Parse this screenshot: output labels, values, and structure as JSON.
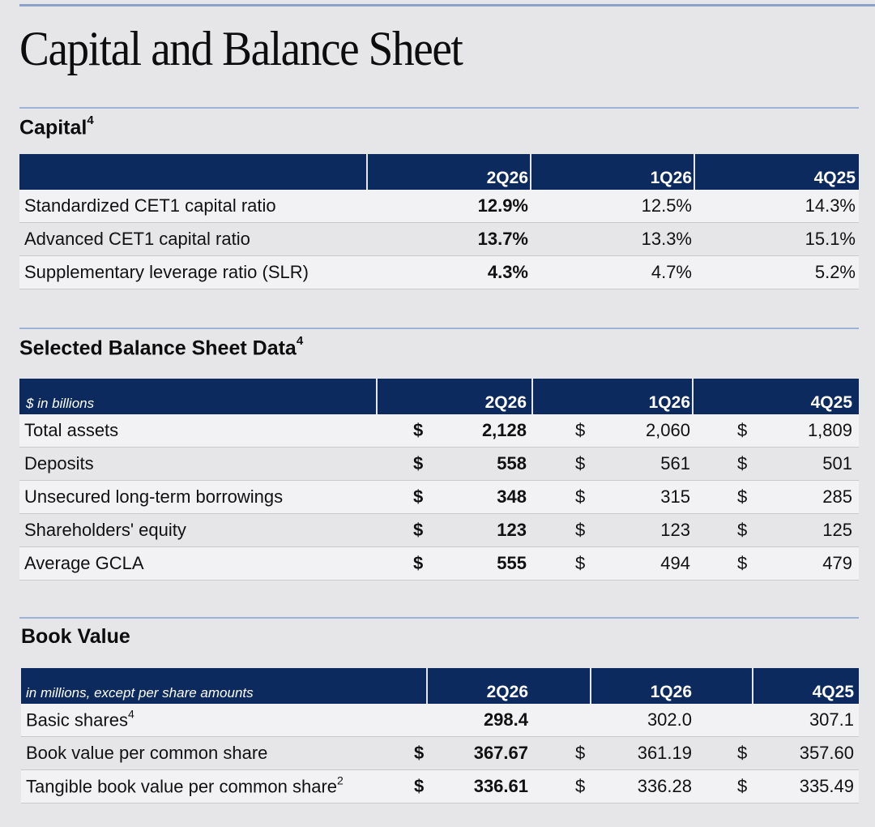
{
  "page": {
    "title": "Capital and Balance Sheet"
  },
  "capital": {
    "title": "Capital",
    "sup": "4",
    "columns": [
      "2Q26",
      "1Q26",
      "4Q25"
    ],
    "rows": [
      {
        "label": "Standardized CET1 capital ratio",
        "values": [
          "12.9%",
          "12.5%",
          "14.3%"
        ]
      },
      {
        "label": "Advanced CET1 capital ratio",
        "values": [
          "13.7%",
          "13.3%",
          "15.1%"
        ]
      },
      {
        "label": "Supplementary leverage ratio (SLR)",
        "values": [
          "4.3%",
          "4.7%",
          "5.2%"
        ]
      }
    ]
  },
  "balance_sheet": {
    "title": "Selected Balance Sheet Data",
    "sup": "4",
    "unit": "$ in billions",
    "currency": "$",
    "columns": [
      "2Q26",
      "1Q26",
      "4Q25"
    ],
    "rows": [
      {
        "label": "Total assets",
        "values": [
          "2,128",
          "2,060",
          "1,809"
        ]
      },
      {
        "label": "Deposits",
        "values": [
          "558",
          "561",
          "501"
        ]
      },
      {
        "label": "Unsecured long-term borrowings",
        "values": [
          "348",
          "315",
          "285"
        ]
      },
      {
        "label": "Shareholders' equity",
        "values": [
          "123",
          "123",
          "125"
        ]
      },
      {
        "label": "Average GCLA",
        "values": [
          "555",
          "494",
          "479"
        ]
      }
    ]
  },
  "book_value": {
    "title": "Book Value",
    "unit": "in millions, except per share amounts",
    "currency": "$",
    "columns": [
      "2Q26",
      "1Q26",
      "4Q25"
    ],
    "rows": [
      {
        "label": "Basic shares",
        "sup": "4",
        "values": [
          "298.4",
          "302.0",
          "307.1"
        ]
      },
      {
        "label": "Book value per common share",
        "values": [
          "367.67",
          "361.19",
          "357.60"
        ]
      },
      {
        "label": "Tangible book value per common share",
        "sup": "2",
        "values": [
          "336.61",
          "336.28",
          "335.49"
        ]
      }
    ]
  },
  "colors": {
    "header_band": "#0c2a5e",
    "rule": "#9cb3d6",
    "background": "#e6e6e8"
  }
}
